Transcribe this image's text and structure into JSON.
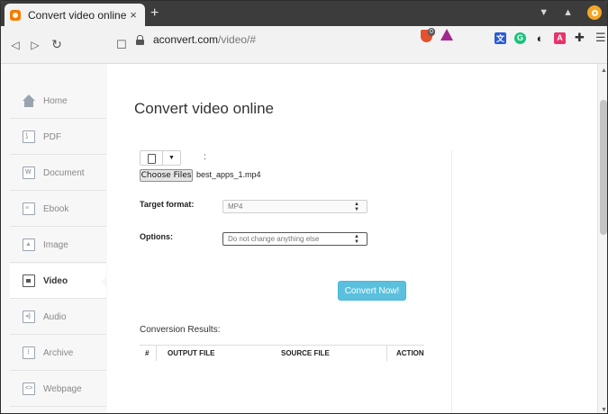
{
  "browser": {
    "tab_title": "Convert video online",
    "tab_close": "×",
    "new_tab": "+",
    "url_host": "aconvert.com",
    "url_path": "/video/#",
    "brave_badge": "0",
    "extensions": [
      "translate-extension-icon",
      "grammarly-icon",
      "blocker-icon",
      "font-icon",
      "puzzle-icon"
    ]
  },
  "sidebar": {
    "items": [
      {
        "label": "Home",
        "icon": "home-icon"
      },
      {
        "label": "PDF",
        "icon": "pdf-icon"
      },
      {
        "label": "Document",
        "icon": "document-icon"
      },
      {
        "label": "Ebook",
        "icon": "ebook-icon"
      },
      {
        "label": "Image",
        "icon": "image-icon"
      },
      {
        "label": "Video",
        "icon": "video-icon",
        "active": true
      },
      {
        "label": "Audio",
        "icon": "audio-icon"
      },
      {
        "label": "Archive",
        "icon": "archive-icon"
      },
      {
        "label": "Webpage",
        "icon": "webpage-icon"
      }
    ]
  },
  "main": {
    "title": "Convert video online",
    "source_colon": ":",
    "choose_files_label": "Choose Files",
    "selected_file": "best_apps_1.mp4",
    "target_format_label": "Target format:",
    "target_format_value": "MP4",
    "options_label": "Options:",
    "options_value": "Do not change anything else",
    "convert_button": "Convert Now!",
    "results_label": "Conversion Results:",
    "table_headers": [
      "#",
      "OUTPUT FILE",
      "SOURCE FILE",
      "ACTION"
    ]
  },
  "colors": {
    "accent": "#5bc0de",
    "tab_strip": "#3c3c3c",
    "brave_shield": "#e2522f"
  }
}
